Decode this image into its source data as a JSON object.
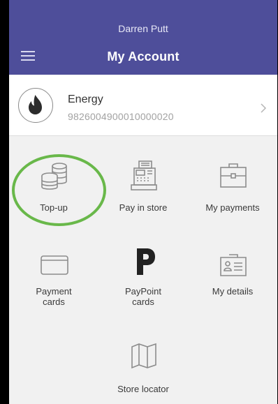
{
  "header": {
    "user_name": "Darren Putt",
    "title": "My Account"
  },
  "account": {
    "name": "Energy",
    "number": "9826004900010000020"
  },
  "tiles": [
    {
      "label": "Top-up",
      "icon": "coins-stack-icon"
    },
    {
      "label": "Pay in store",
      "icon": "cash-register-icon"
    },
    {
      "label": "My payments",
      "icon": "briefcase-icon"
    },
    {
      "label": "Payment\ncards",
      "icon": "credit-card-icon"
    },
    {
      "label": "PayPoint\ncards",
      "icon": "paypoint-logo-icon"
    },
    {
      "label": "My details",
      "icon": "id-card-icon"
    },
    {
      "label": "Store locator",
      "icon": "map-icon"
    }
  ],
  "colors": {
    "header_bg": "#4e4e9a",
    "highlight": "#69b84a",
    "icon_stroke": "#8c8c8c"
  }
}
